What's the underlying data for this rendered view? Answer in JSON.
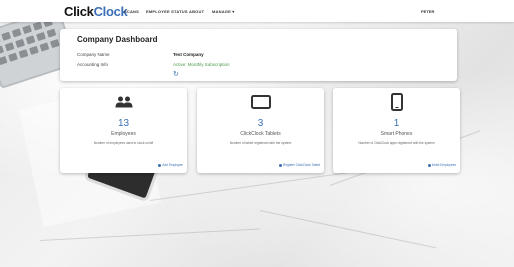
{
  "navbar": {
    "logo_part1": "Click",
    "logo_part2": "Clock",
    "items": [
      "SCANS",
      "EMPLOYEE STATUS",
      "ABOUT",
      "MANAGE ▾"
    ],
    "user": "PETER"
  },
  "dashboard": {
    "title": "Company Dashboard",
    "company_name_label": "Company Name",
    "company_name_value": "Test Company",
    "accounting_label": "Accounting Info",
    "accounting_value": "Active: Monthly Subscription",
    "refresh_icon": "refresh-icon"
  },
  "stats": [
    {
      "icon": "people-icon",
      "number": "13",
      "label": "Employees",
      "description": "Number of employees used to clock on/off",
      "link": "Add Employee"
    },
    {
      "icon": "tablet-icon",
      "number": "3",
      "label": "ClickClock Tablets",
      "description": "Number of tablet registered with the system",
      "link": "Register ClickClock Tablet"
    },
    {
      "icon": "phone-icon",
      "number": "1",
      "label": "Smart Phones",
      "description": "Number of ClickClock apps registered with the system",
      "link": "Invite Employees"
    }
  ],
  "colors": {
    "accent_blue": "#3c6fb6",
    "status_green": "#4a9b4a"
  }
}
